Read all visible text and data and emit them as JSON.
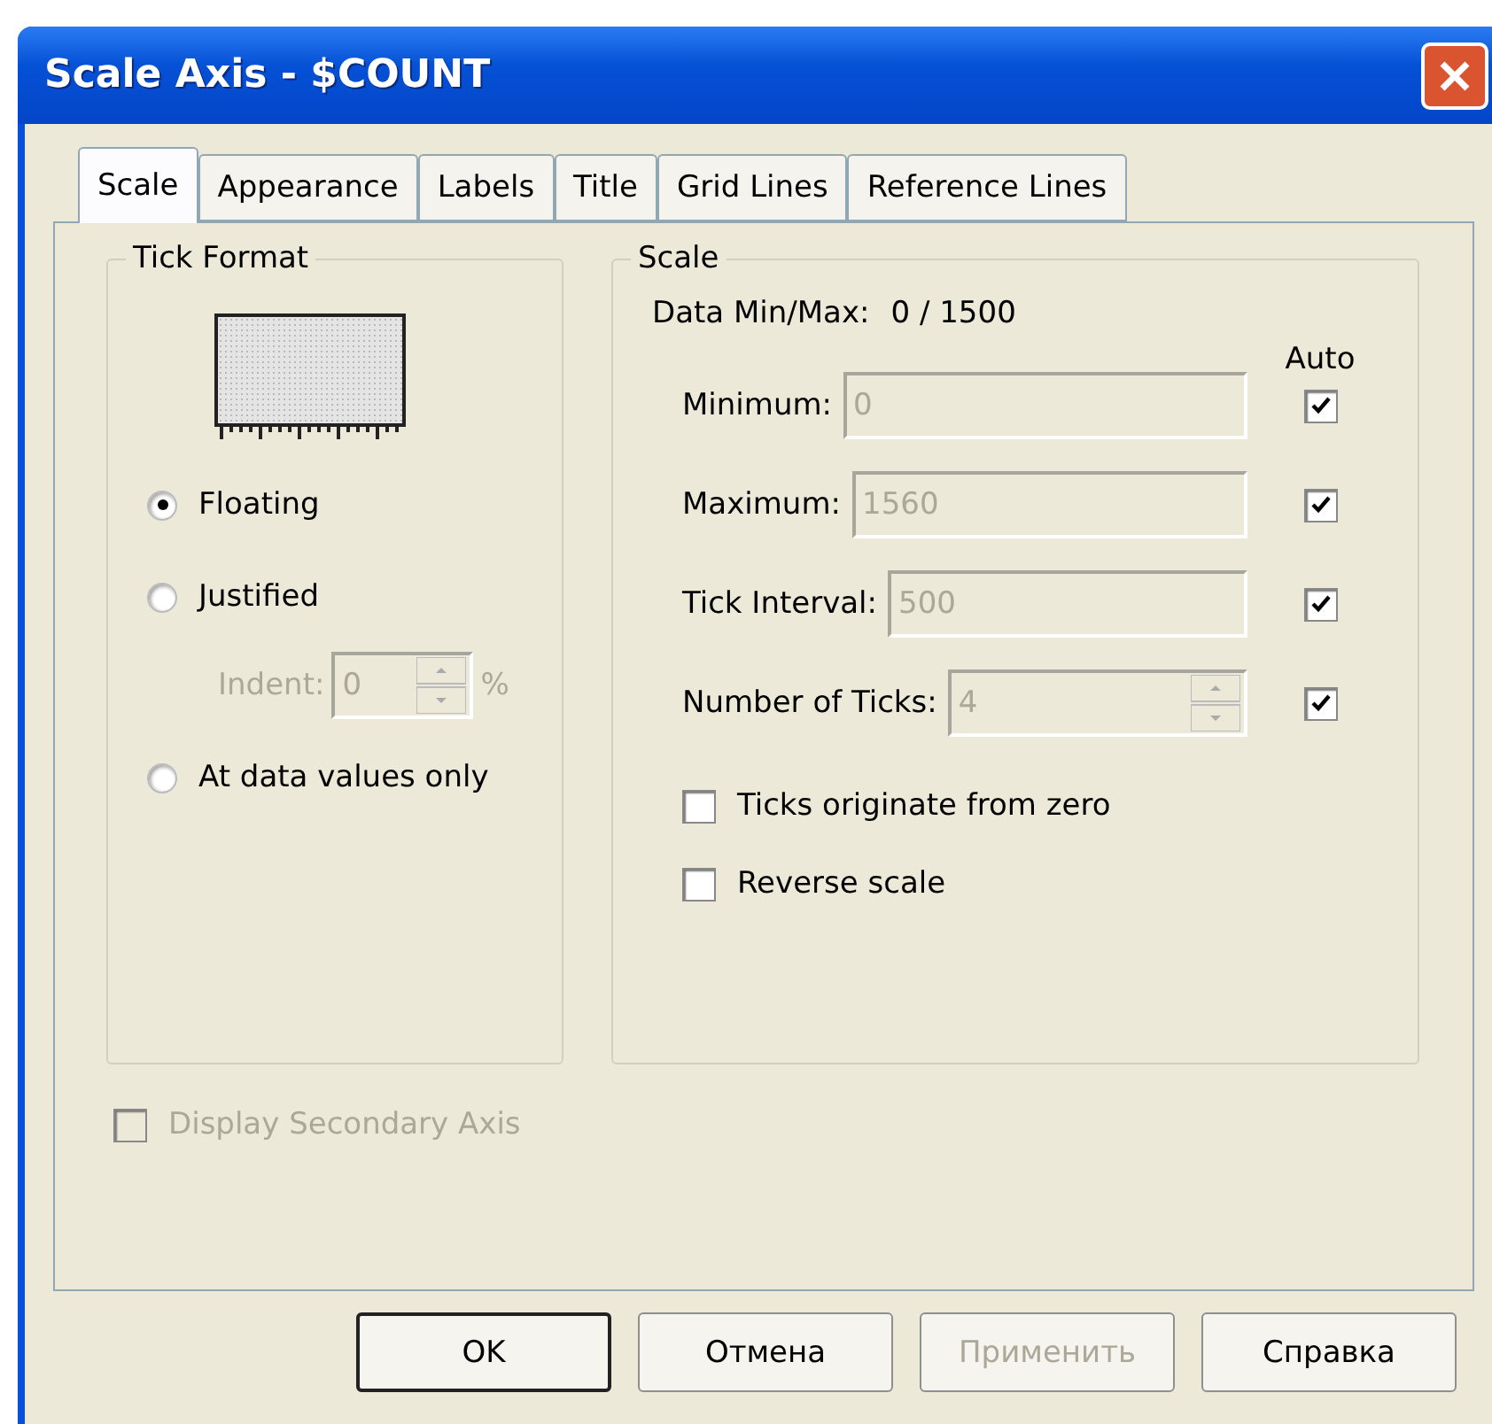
{
  "window": {
    "title": "Scale Axis - $COUNT"
  },
  "tabs": [
    {
      "label": "Scale",
      "selected": true
    },
    {
      "label": "Appearance",
      "selected": false
    },
    {
      "label": "Labels",
      "selected": false
    },
    {
      "label": "Title",
      "selected": false
    },
    {
      "label": "Grid Lines",
      "selected": false
    },
    {
      "label": "Reference Lines",
      "selected": false
    }
  ],
  "tick_format": {
    "title": "Tick Format",
    "options": [
      {
        "label": "Floating",
        "selected": true
      },
      {
        "label": "Justified",
        "selected": false
      },
      {
        "label": "At data values only",
        "selected": false
      }
    ],
    "indent": {
      "label": "Indent:",
      "value": "0",
      "unit": "%",
      "disabled": true
    }
  },
  "scale": {
    "title": "Scale",
    "data_minmax_label": "Data Min/Max:",
    "data_minmax_value": "0 / 1500",
    "auto_header": "Auto",
    "fields": [
      {
        "label": "Minimum:",
        "value": "0",
        "kind": "text",
        "auto": true
      },
      {
        "label": "Maximum:",
        "value": "1560",
        "kind": "text",
        "auto": true
      },
      {
        "label": "Tick Interval:",
        "value": "500",
        "kind": "text",
        "auto": true
      },
      {
        "label": "Number of Ticks:",
        "value": "4",
        "kind": "spinner",
        "auto": true
      }
    ],
    "checkboxes": [
      {
        "label": "Ticks originate from zero",
        "checked": false
      },
      {
        "label": "Reverse scale",
        "checked": false
      }
    ]
  },
  "secondary_axis": {
    "label": "Display Secondary Axis",
    "checked": false,
    "disabled": true
  },
  "buttons": [
    {
      "label": "OK",
      "default": true,
      "disabled": false
    },
    {
      "label": "Отмена",
      "default": false,
      "disabled": false
    },
    {
      "label": "Применить",
      "default": false,
      "disabled": true
    },
    {
      "label": "Справка",
      "default": false,
      "disabled": false
    }
  ]
}
